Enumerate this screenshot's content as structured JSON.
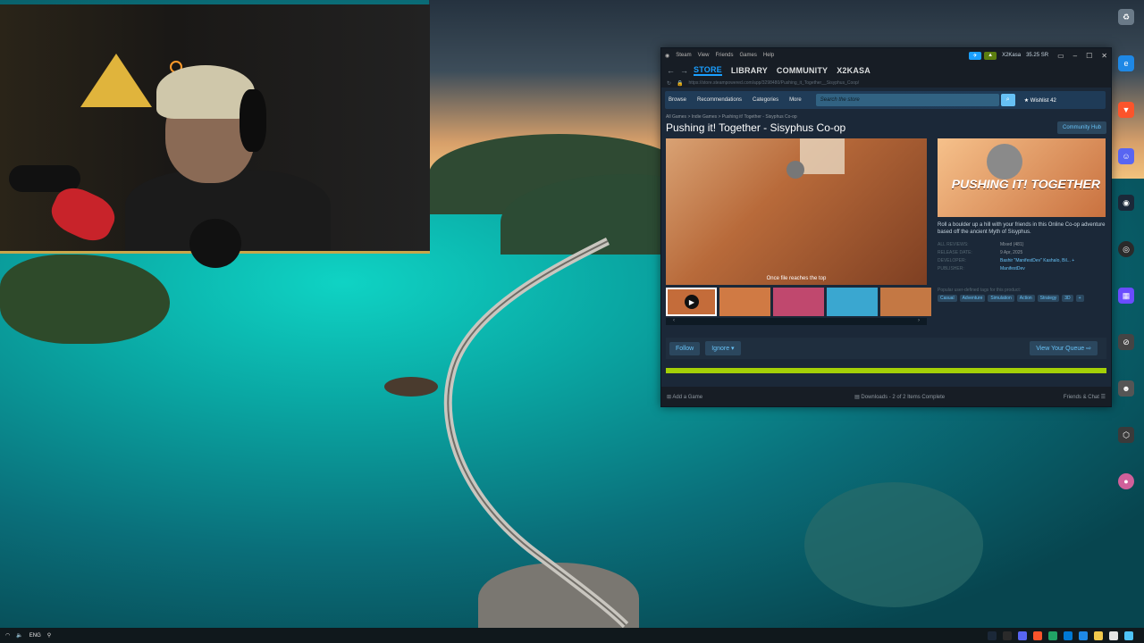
{
  "steam": {
    "menu": [
      "Steam",
      "View",
      "Friends",
      "Games",
      "Help"
    ],
    "user": "X2Kasa",
    "balance": "35.25 SR",
    "tabs": [
      "STORE",
      "LIBRARY",
      "COMMUNITY",
      "X2KASA"
    ],
    "url": "https://store.steampowered.com/app/3298480/Pushing_it_Together__Sisyphus_Coop/",
    "storenav": {
      "browse": "Browse",
      "recommendations": "Recommendations",
      "categories": "Categories",
      "more": "More",
      "search_placeholder": "Search the store",
      "wishlist": "Wishlist",
      "wishlist_count": "42"
    },
    "breadcrumb": "All Games > Indie Games > Pushing it! Together - Sisyphus Co-op",
    "game_title": "Pushing it! Together - Sisyphus Co-op",
    "community_hub": "Community Hub",
    "video_caption": "Once file reaches the top",
    "capsule_logo": "PUSHING IT! TOGETHER",
    "description": "Roll a boulder up a hill with your friends in this Online Co-op adventure based off the ancient Myth of Sisyphus.",
    "meta": [
      {
        "k": "ALL REVIEWS:",
        "v": "Mixed (481)"
      },
      {
        "k": "RELEASE DATE:",
        "v": "9 Apr, 2025"
      },
      {
        "k": "DEVELOPER:",
        "v": "Bashir \"ManifestDev\" Kashalo, Bil... +"
      },
      {
        "k": "PUBLISHER:",
        "v": "ManifestDev"
      }
    ],
    "tags_label": "Popular user-defined tags for this product:",
    "tags": [
      "Casual",
      "Adventure",
      "Simulation",
      "Action",
      "Strategy",
      "3D",
      "+"
    ],
    "follow": "Follow",
    "ignore": "Ignore",
    "view_queue": "View Your Queue",
    "status": {
      "add_game": "Add a Game",
      "downloads": "Downloads - 2 of 2 Items Complete",
      "friends": "Friends & Chat"
    }
  },
  "desktop_icons": [
    {
      "name": "Microsoft Edge",
      "color": "#1e88e5"
    },
    {
      "name": "Brave",
      "color": "#fb542b"
    },
    {
      "name": "Discord",
      "color": "#5865f2"
    },
    {
      "name": "Steam",
      "color": "#1b2838"
    },
    {
      "name": "OBS Studio",
      "color": "#2a2a2a"
    },
    {
      "name": "Elgato Stream Deck",
      "color": "#6a4cff"
    },
    {
      "name": "Call Service Together",
      "color": "#444444"
    },
    {
      "name": "Outbound Demo",
      "color": "#3a3a3a"
    },
    {
      "name": "Pushing it! Together",
      "color": "#d0609a"
    }
  ],
  "taskbar": {
    "lang": "ENG"
  }
}
